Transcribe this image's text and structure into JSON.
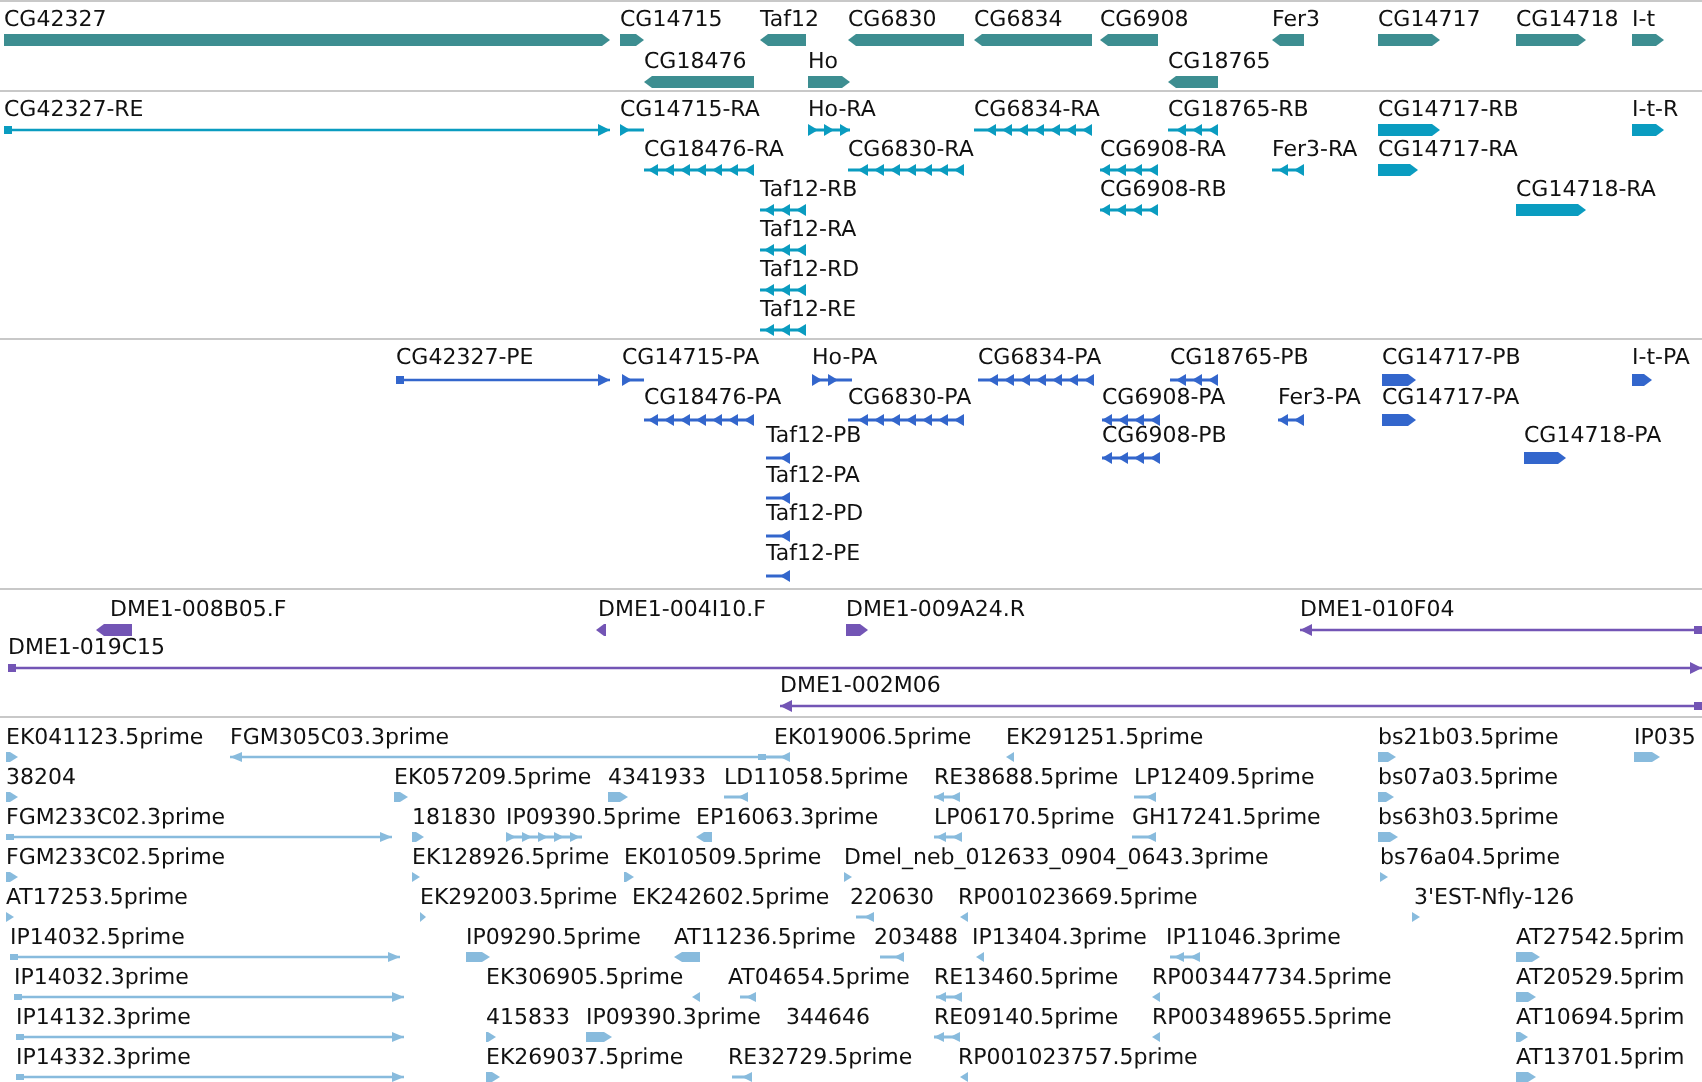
{
  "tracks": [
    {
      "kind": "gene",
      "color": "#3d8e91",
      "features": [
        {
          "label": "CG42327",
          "reverse": false
        },
        {
          "label": "CG14715",
          "reverse": false
        },
        {
          "label": "Taf12",
          "reverse": true
        },
        {
          "label": "CG6830",
          "reverse": true
        },
        {
          "label": "CG6834",
          "reverse": true
        },
        {
          "label": "CG6908",
          "reverse": true
        },
        {
          "label": "Fer3",
          "reverse": true
        },
        {
          "label": "CG14717",
          "reverse": false
        },
        {
          "label": "CG14718",
          "reverse": false
        },
        {
          "label": "I-t",
          "reverse": false
        },
        {
          "label": "CG18476",
          "reverse": true
        },
        {
          "label": "Ho",
          "reverse": false
        },
        {
          "label": "CG18765",
          "reverse": true
        }
      ]
    },
    {
      "kind": "transcript",
      "color": "#0a9cc0",
      "features": [
        {
          "label": "CG42327-RE",
          "reverse": false
        },
        {
          "label": "CG14715-RA",
          "reverse": false
        },
        {
          "label": "Ho-RA",
          "reverse": false
        },
        {
          "label": "CG6834-RA",
          "reverse": true
        },
        {
          "label": "CG18765-RB",
          "reverse": true
        },
        {
          "label": "CG14717-RB",
          "reverse": false
        },
        {
          "label": "I-t-R",
          "reverse": false
        },
        {
          "label": "CG18476-RA",
          "reverse": true
        },
        {
          "label": "CG6830-RA",
          "reverse": true
        },
        {
          "label": "CG6908-RA",
          "reverse": true
        },
        {
          "label": "Fer3-RA",
          "reverse": true
        },
        {
          "label": "CG14717-RA",
          "reverse": false
        },
        {
          "label": "Taf12-RB",
          "reverse": true
        },
        {
          "label": "CG6908-RB",
          "reverse": true
        },
        {
          "label": "CG14718-RA",
          "reverse": false
        },
        {
          "label": "Taf12-RA",
          "reverse": true
        },
        {
          "label": "Taf12-RD",
          "reverse": true
        },
        {
          "label": "Taf12-RE",
          "reverse": true
        }
      ]
    },
    {
      "kind": "protein",
      "color": "#3366cc",
      "features": [
        {
          "label": "CG42327-PE",
          "reverse": false
        },
        {
          "label": "CG14715-PA",
          "reverse": false
        },
        {
          "label": "Ho-PA",
          "reverse": false
        },
        {
          "label": "CG6834-PA",
          "reverse": true
        },
        {
          "label": "CG18765-PB",
          "reverse": true
        },
        {
          "label": "CG14717-PB",
          "reverse": false
        },
        {
          "label": "I-t-PA",
          "reverse": false
        },
        {
          "label": "CG18476-PA",
          "reverse": true
        },
        {
          "label": "CG6830-PA",
          "reverse": true
        },
        {
          "label": "CG6908-PA",
          "reverse": true
        },
        {
          "label": "Fer3-PA",
          "reverse": true
        },
        {
          "label": "CG14717-PA",
          "reverse": false
        },
        {
          "label": "Taf12-PB",
          "reverse": true
        },
        {
          "label": "CG6908-PB",
          "reverse": true
        },
        {
          "label": "CG14718-PA",
          "reverse": false
        },
        {
          "label": "Taf12-PA",
          "reverse": true
        },
        {
          "label": "Taf12-PD",
          "reverse": true
        },
        {
          "label": "Taf12-PE",
          "reverse": true
        }
      ]
    },
    {
      "kind": "clone",
      "color": "#7355b5",
      "features": [
        {
          "label": "DME1-008B05.F",
          "reverse": true
        },
        {
          "label": "DME1-004I10.F",
          "reverse": true
        },
        {
          "label": "DME1-009A24.R",
          "reverse": false
        },
        {
          "label": "DME1-010F04",
          "reverse": true
        },
        {
          "label": "DME1-019C15",
          "reverse": false
        },
        {
          "label": "DME1-002M06",
          "reverse": true
        }
      ]
    },
    {
      "kind": "est",
      "color": "#88bbdd",
      "features": [
        {
          "label": "EK041123.5prime",
          "reverse": false
        },
        {
          "label": "FGM305C03.3prime",
          "reverse": true
        },
        {
          "label": "EK019006.5prime",
          "reverse": true
        },
        {
          "label": "EK291251.5prime",
          "reverse": true
        },
        {
          "label": "bs21b03.5prime",
          "reverse": false
        },
        {
          "label": "IP035",
          "reverse": false
        },
        {
          "label": "38204",
          "reverse": false
        },
        {
          "label": "EK057209.5prime",
          "reverse": false
        },
        {
          "label": "4341933",
          "reverse": false
        },
        {
          "label": "LD11058.5prime",
          "reverse": true
        },
        {
          "label": "RE38688.5prime",
          "reverse": true
        },
        {
          "label": "LP12409.5prime",
          "reverse": true
        },
        {
          "label": "bs07a03.5prime",
          "reverse": false
        },
        {
          "label": "FGM233C02.3prime",
          "reverse": false
        },
        {
          "label": "181830",
          "reverse": false
        },
        {
          "label": "IP09390.5prime",
          "reverse": false
        },
        {
          "label": "EP16063.3prime",
          "reverse": true
        },
        {
          "label": "LP06170.5prime",
          "reverse": true
        },
        {
          "label": "GH17241.5prime",
          "reverse": true
        },
        {
          "label": "bs63h03.5prime",
          "reverse": false
        },
        {
          "label": "FGM233C02.5prime",
          "reverse": false
        },
        {
          "label": "EK128926.5prime",
          "reverse": false
        },
        {
          "label": "EK010509.5prime",
          "reverse": false
        },
        {
          "label": "Dmel_neb_012633_0904_0643.3prime",
          "reverse": false
        },
        {
          "label": "bs76a04.5prime",
          "reverse": false
        },
        {
          "label": "AT17253.5prime",
          "reverse": false
        },
        {
          "label": "EK292003.5prime",
          "reverse": false
        },
        {
          "label": "EK242602.5prime"
        },
        {
          "label": "220630",
          "reverse": true
        },
        {
          "label": "RP001023669.5prime",
          "reverse": true
        },
        {
          "label": "3'EST-Nfly-126",
          "reverse": false
        },
        {
          "label": "IP14032.5prime",
          "reverse": false
        },
        {
          "label": "IP09290.5prime",
          "reverse": false
        },
        {
          "label": "AT11236.5prime",
          "reverse": true
        },
        {
          "label": "203488",
          "reverse": true
        },
        {
          "label": "IP13404.3prime",
          "reverse": true
        },
        {
          "label": "IP11046.3prime",
          "reverse": true
        },
        {
          "label": "AT27542.5prim",
          "reverse": false
        },
        {
          "label": "IP14032.3prime",
          "reverse": false
        },
        {
          "label": "EK306905.5prime",
          "reverse": true
        },
        {
          "label": "AT04654.5prime",
          "reverse": true
        },
        {
          "label": "RE13460.5prime",
          "reverse": true
        },
        {
          "label": "RP003447734.5prime",
          "reverse": true
        },
        {
          "label": "AT20529.5prim",
          "reverse": false
        },
        {
          "label": "IP14132.3prime",
          "reverse": false
        },
        {
          "label": "415833",
          "reverse": false
        },
        {
          "label": "IP09390.3prime",
          "reverse": false
        },
        {
          "label": "344646"
        },
        {
          "label": "RE09140.5prime",
          "reverse": true
        },
        {
          "label": "RP003489655.5prime",
          "reverse": true
        },
        {
          "label": "AT10694.5prim",
          "reverse": false
        },
        {
          "label": "IP14332.3prime",
          "reverse": false
        },
        {
          "label": "EK269037.5prime",
          "reverse": false
        },
        {
          "label": "RE32729.5prime",
          "reverse": true
        },
        {
          "label": "RP001023757.5prime",
          "reverse": true
        },
        {
          "label": "AT13701.5prim",
          "reverse": false
        }
      ]
    }
  ]
}
